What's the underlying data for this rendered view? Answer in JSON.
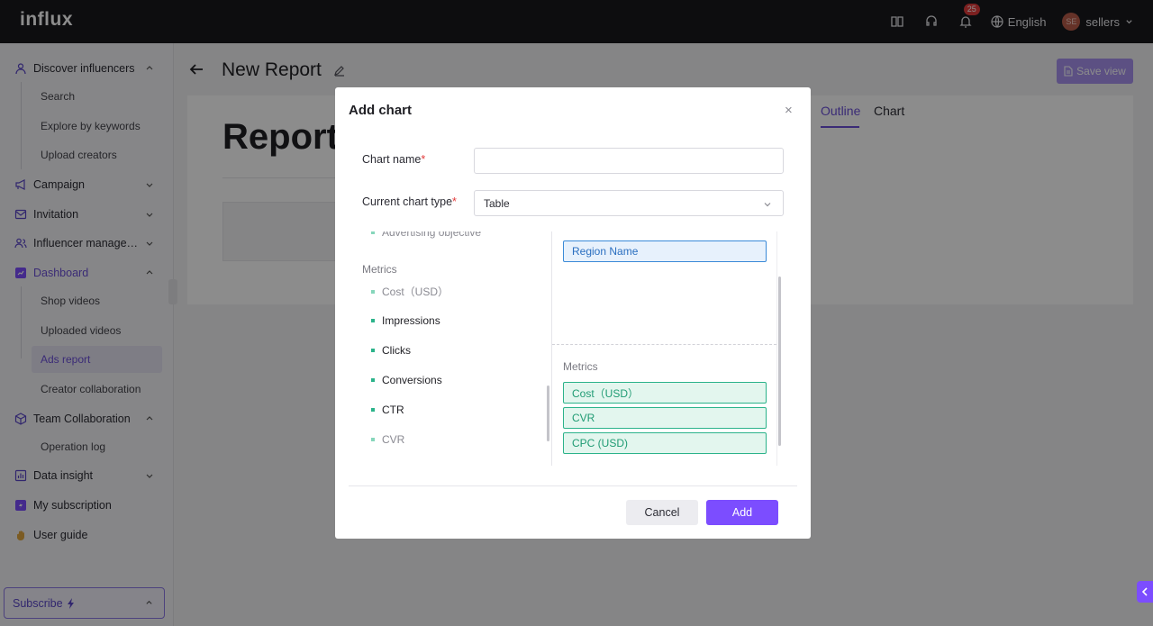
{
  "app": {
    "logo": "influx"
  },
  "header": {
    "notification_count": "25",
    "language": "English",
    "avatar_initials": "SE",
    "user_name": "sellers"
  },
  "sidebar": {
    "items": [
      {
        "label": "Discover influencers"
      },
      {
        "label": "Campaign"
      },
      {
        "label": "Invitation"
      },
      {
        "label": "Influencer management"
      },
      {
        "label": "Dashboard"
      },
      {
        "label": "Team Collaboration"
      },
      {
        "label": "Data insight"
      },
      {
        "label": "My subscription"
      },
      {
        "label": "User guide"
      }
    ],
    "discover_sub": [
      "Search",
      "Explore by keywords",
      "Upload creators"
    ],
    "dashboard_sub": [
      "Shop videos",
      "Uploaded videos",
      "Ads report",
      "Creator collaboration"
    ],
    "team_sub": [
      "Operation log"
    ],
    "subscribe_label": "Subscribe"
  },
  "page": {
    "title": "New Report",
    "save_view_label": "Save view",
    "report_heading": "Report",
    "tabs": [
      "Outline",
      "Chart"
    ]
  },
  "modal": {
    "title": "Add chart",
    "chart_name_label": "Chart name",
    "chart_name_value": "",
    "chart_type_label": "Current chart type",
    "chart_type_value": "Table",
    "left_partial_field": "Advertising objective",
    "metrics_label": "Metrics",
    "left_metrics": [
      "Cost（USD）",
      "Impressions",
      "Clicks",
      "Conversions",
      "CTR",
      "CVR"
    ],
    "dimension_chip": "Region Name",
    "right_metrics_label": "Metrics",
    "selected_metrics": [
      "Cost（USD）",
      "CVR",
      "CPC (USD)"
    ],
    "cancel_label": "Cancel",
    "add_label": "Add"
  }
}
